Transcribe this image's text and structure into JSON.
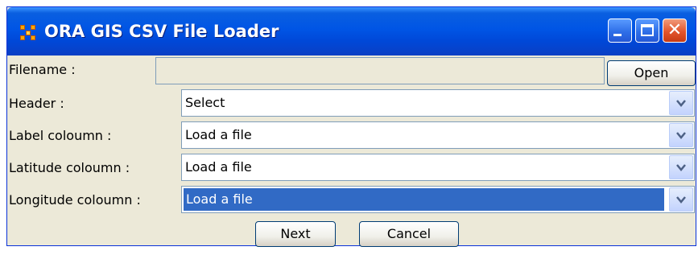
{
  "window": {
    "title": "ORA GIS CSV File Loader"
  },
  "titlebar_buttons": {
    "minimize": "minimize-icon",
    "maximize": "maximize-icon",
    "close": "close-icon",
    "close_glyph": "✕"
  },
  "form": {
    "filename_label": "Filename :",
    "filename_value": "",
    "open_label": "Open",
    "rows": [
      {
        "label": "Header :",
        "value": "Select"
      },
      {
        "label": "Label coloumn :",
        "value": "Load a file"
      },
      {
        "label": "Latitude coloumn :",
        "value": "Load a file"
      },
      {
        "label": "Longitude coloumn :",
        "value": "Load a file"
      }
    ]
  },
  "buttons": {
    "next": "Next",
    "cancel": "Cancel"
  },
  "colors": {
    "titlebar": "#0055e5",
    "dialog_bg": "#ece9d8",
    "selection": "#316ac5"
  }
}
